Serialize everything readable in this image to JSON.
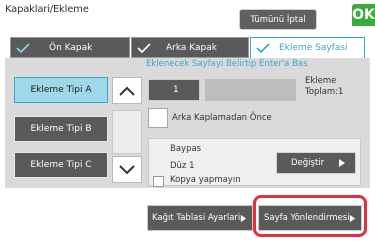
{
  "header": {
    "title": "Kapaklari/Ekleme",
    "cancel_all_label": "Tümünü İptal",
    "ok_label": "OK"
  },
  "tabs": [
    {
      "label": "Ön Kapak",
      "checked": true,
      "active": false
    },
    {
      "label": "Arka Kapak",
      "checked": true,
      "active": false
    },
    {
      "label": "Ekleme Sayfasi",
      "checked": true,
      "active": true
    }
  ],
  "hint": "Eklenecek Sayfayi Belirtip Enter'a Bas",
  "insertion_types": [
    "Ekleme Tipi A",
    "Ekleme Tipi B",
    "Ekleme Tipi C"
  ],
  "selected_type": "Ekleme Tipi A",
  "page_number_value": "1",
  "total_label": "Ekleme\nToplam:1",
  "total_label_line1": "Ekleme",
  "total_label_line2": "Toplam:1",
  "option_checkbox_label": "Arka Kaplamadan Önce",
  "paper_settings": {
    "tray": "Baypas",
    "side": "Düz 1",
    "copy": "Kopya yapmayın"
  },
  "change_button_label": "Değiştir",
  "bottom": {
    "paper_tray_button": "Kağıt Tablasi Ayarlari",
    "page_orientation_button": "Sayfa Yönlendirmesi"
  },
  "colors": {
    "accent": "#37a8c9",
    "ok_green": "#3caa3c",
    "highlight_red": "#e0313f",
    "button_gray": "#5a5a5a"
  }
}
